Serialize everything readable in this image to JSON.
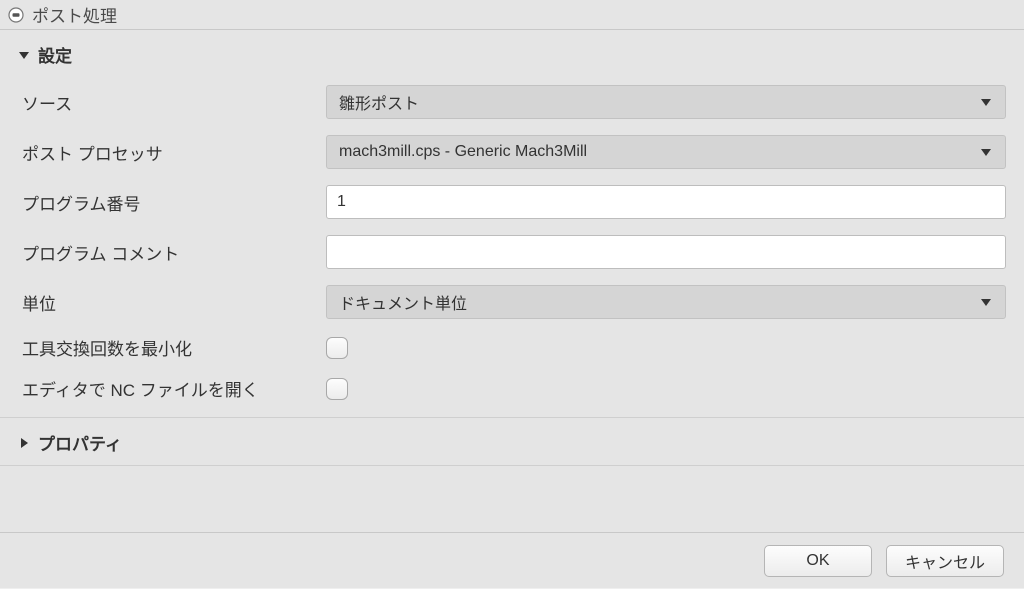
{
  "window": {
    "title": "ポスト処理"
  },
  "sections": {
    "settings": {
      "title": "設定",
      "fields": {
        "source": {
          "label": "ソース",
          "value": "雛形ポスト"
        },
        "post_processor": {
          "label": "ポスト プロセッサ",
          "value": "mach3mill.cps - Generic Mach3Mill"
        },
        "program_number": {
          "label": "プログラム番号",
          "value": "1"
        },
        "program_comment": {
          "label": "プログラム コメント",
          "value": ""
        },
        "units": {
          "label": "単位",
          "value": "ドキュメント単位"
        },
        "minimize_tool_changes": {
          "label": "工具交換回数を最小化",
          "checked": false
        },
        "open_nc_in_editor": {
          "label": "エディタで NC ファイルを開く",
          "checked": false
        }
      }
    },
    "properties": {
      "title": "プロパティ"
    }
  },
  "footer": {
    "ok": "OK",
    "cancel": "キャンセル"
  }
}
